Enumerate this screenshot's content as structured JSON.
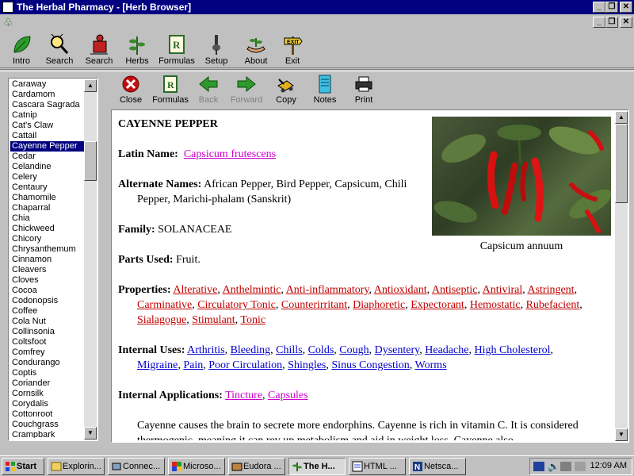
{
  "window": {
    "title": "The Herbal Pharmacy - [Herb Browser]",
    "controls": [
      "_",
      "❐",
      "✕"
    ],
    "inner_controls": [
      "_",
      "❐",
      "✕"
    ]
  },
  "toolbar": {
    "items": [
      {
        "label": "Intro",
        "icon": "leaf-icon"
      },
      {
        "label": "Search",
        "icon": "magnifier-icon"
      },
      {
        "label": "Search",
        "icon": "figure-search-icon"
      },
      {
        "label": "Herbs",
        "icon": "plant-icon"
      },
      {
        "label": "Formulas",
        "icon": "prescription-book-icon"
      },
      {
        "label": "Setup",
        "icon": "mortar-icon"
      },
      {
        "label": "About",
        "icon": "hands-plant-icon"
      },
      {
        "label": "Exit",
        "icon": "exit-sign-icon"
      }
    ]
  },
  "herb_list": {
    "items": [
      "Caraway",
      "Cardamom",
      "Cascara Sagrada",
      "Catnip",
      "Cat's Claw",
      "Cattail",
      "Cayenne Pepper",
      "Cedar",
      "Celandine",
      "Celery",
      "Centaury",
      "Chamomile",
      "Chaparral",
      "Chia",
      "Chickweed",
      "Chicory",
      "Chrysanthemum",
      "Cinnamon",
      "Cleavers",
      "Cloves",
      "Cocoa",
      "Codonopsis",
      "Coffee",
      "Cola Nut",
      "Collinsonia",
      "Coltsfoot",
      "Comfrey",
      "Condurango",
      "Coptis",
      "Coriander",
      "Cornsilk",
      "Corydalis",
      "Cottonroot",
      "Couchgrass",
      "Crampbark"
    ],
    "selected": "Cayenne Pepper"
  },
  "subtoolbar": {
    "items": [
      {
        "label": "Close",
        "icon": "close-icon",
        "enabled": true
      },
      {
        "label": "Formulas",
        "icon": "formulas-book-icon",
        "enabled": true
      },
      {
        "label": "Back",
        "icon": "back-arrow-icon",
        "enabled": false
      },
      {
        "label": "Forward",
        "icon": "forward-arrow-icon",
        "enabled": false
      },
      {
        "label": "Copy",
        "icon": "copy-icon",
        "enabled": true
      },
      {
        "label": "Notes",
        "icon": "notes-icon",
        "enabled": true
      },
      {
        "label": "Print",
        "icon": "printer-icon",
        "enabled": true
      }
    ]
  },
  "herb": {
    "name": "CAYENNE PEPPER",
    "latin_label": "Latin Name:",
    "latin": "Capsicum frutescens",
    "alternate_label": "Alternate Names:",
    "alternate": "African Pepper, Bird Pepper, Capsicum, Chili Pepper, Marichi-phalam (Sanskrit)",
    "family_label": "Family:",
    "family": "SOLANACEAE",
    "parts_label": "Parts Used:",
    "parts": "Fruit.",
    "properties_label": "Properties:",
    "properties": [
      "Alterative",
      "Anthelmintic",
      "Anti-inflammatory",
      "Antioxidant",
      "Antiseptic",
      "Antiviral",
      "Astringent",
      "Carminative",
      "Circulatory Tonic",
      "Counterirritant",
      "Diaphoretic",
      "Expectorant",
      "Hemostatic",
      "Rubefacient",
      "Sialagogue",
      "Stimulant",
      "Tonic"
    ],
    "internal_uses_label": "Internal Uses:",
    "internal_uses": [
      "Arthritis",
      "Bleeding",
      "Chills",
      "Colds",
      "Cough",
      "Dysentery",
      "Headache",
      "High Cholesterol",
      "Migraine",
      "Pain",
      "Poor Circulation",
      "Shingles",
      "Sinus Congestion",
      "Worms"
    ],
    "applications_label": "Internal Applications:",
    "applications": [
      "Tincture",
      "Capsules"
    ],
    "description": "Cayenne causes the brain to secrete more endorphins.  Cayenne is rich in vitamin C.  It is considered thermogenic, meaning it can rev up metabolism and aid in weight loss.  Cayenne also",
    "photo_caption": "Capsicum annuum"
  },
  "taskbar": {
    "start": "Start",
    "tasks": [
      {
        "label": "Explorin...",
        "active": false
      },
      {
        "label": "Connec...",
        "active": false
      },
      {
        "label": "Microso...",
        "active": false
      },
      {
        "label": "Eudora ...",
        "active": false
      },
      {
        "label": "The H...",
        "active": true
      },
      {
        "label": "HTML ...",
        "active": false
      },
      {
        "label": "Netsca...",
        "active": false
      }
    ],
    "clock": "12:09 AM"
  }
}
